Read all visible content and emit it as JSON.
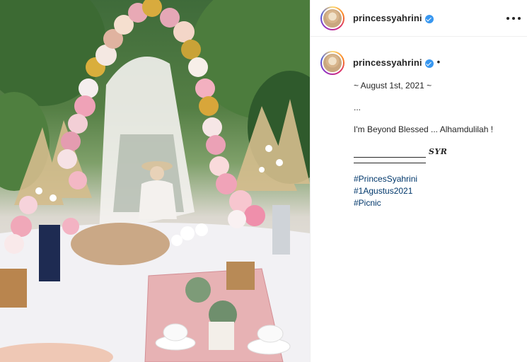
{
  "post": {
    "username": "princessyahrini",
    "more_icon": "more-horizontal-icon",
    "verified_icon": "verified-badge-icon",
    "separator": "•",
    "caption_lines": {
      "date": "~ August 1st, 2021 ~",
      "dots": "...",
      "message": "I'm Beyond Blessed ... Alhamdulilah !",
      "signature": "SYR"
    },
    "hashtags": [
      "#PrincesSyahrini",
      "#1Agustus2021",
      "#Picnic"
    ]
  },
  "colors": {
    "verified": "#3897f0",
    "hashtag": "#00376b",
    "text": "#262626"
  }
}
